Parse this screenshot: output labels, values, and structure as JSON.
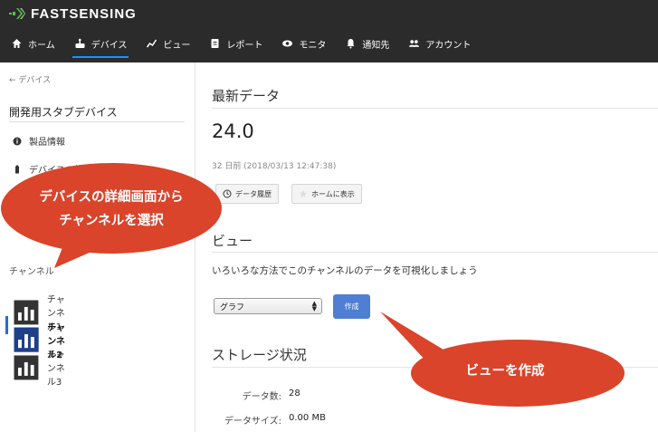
{
  "brand": {
    "name": "FASTSENSING",
    "logo_color": "#5cc34a"
  },
  "nav": [
    {
      "label": "ホーム",
      "icon": "home-icon"
    },
    {
      "label": "デバイス",
      "icon": "device-icon",
      "active": true
    },
    {
      "label": "ビュー",
      "icon": "chart-line-icon"
    },
    {
      "label": "レポート",
      "icon": "report-icon"
    },
    {
      "label": "モニタ",
      "icon": "eye-icon"
    },
    {
      "label": "通知先",
      "icon": "bell-icon"
    },
    {
      "label": "アカウント",
      "icon": "users-icon"
    }
  ],
  "sidebar": {
    "back_label": "← デバイス",
    "device_name": "開発用スタブデバイス",
    "items": [
      {
        "label": "製品情報",
        "icon": "info-icon"
      },
      {
        "label": "デバイスの状態",
        "icon": "battery-icon"
      }
    ],
    "channels_heading": "チャンネル",
    "channels": [
      {
        "label": "チャンネル1",
        "icon": "bar-chart-icon"
      },
      {
        "label": "チャンネル2",
        "icon": "bar-chart-icon",
        "active": true
      },
      {
        "label": "チャンネル3",
        "icon": "bar-chart-icon"
      }
    ]
  },
  "latest": {
    "title": "最新データ",
    "value": "24.0",
    "timestamp": "32 日前 (2018/03/13 12:47:38)",
    "history_button": "データ履歴",
    "home_button": "ホームに表示"
  },
  "view": {
    "title": "ビュー",
    "description": "いろいろな方法でこのチャンネルのデータを可視化しましょう",
    "select_value": "グラフ",
    "create_button": "作成"
  },
  "storage": {
    "title": "ストレージ状況",
    "rows": [
      {
        "label": "データ数:",
        "value": "28"
      },
      {
        "label": "データサイズ:",
        "value": "0.00 MB"
      }
    ]
  },
  "callouts": {
    "detail_line1": "デバイスの詳細画面から",
    "detail_line2": "チャンネルを選択",
    "create_view": "ビューを作成",
    "color": "#d9442b"
  },
  "colors": {
    "topbar": "#2b2b2b",
    "accent": "#1e90ff",
    "button": "#4f7fd2"
  }
}
